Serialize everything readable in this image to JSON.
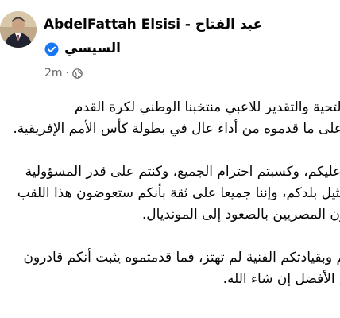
{
  "author": {
    "name_line1": "AbdelFattah Elsisi - عبد الفتاح",
    "name_line2": "السيسي",
    "verified_icon": "verified-badge-icon"
  },
  "meta": {
    "time": "2m",
    "separator": "·",
    "audience_icon": "globe-icon"
  },
  "post": {
    "lines": [
      "أتوجه بكل التحية والتقدير للاعبي منتخبنا الوطني لكرة القدم",
      "على ما قدموه من أداء عال في بطولة كأس الأمم الإفريقية.",
      "لقد أديتم ما عليكم، وكسبتم احترام الجميع، وكنتم على قدر المسؤولية",
      "في تمثيل بلدكم، وإننا جميعا على ثقة بأنكم ستعوضون هذا اللقب",
      "وستسعدون المصريين بالصعود إلى المونديال.",
      "إن عزيمتكم وبقيادتكم الفنية لم تهتز، فما قدمتموه يثبت أنكم قادرون",
      "على تحقيق الأفضل إن شاء الله."
    ]
  },
  "colors": {
    "text": "#050505",
    "secondary": "#65676b",
    "verified": "#1877f2"
  }
}
